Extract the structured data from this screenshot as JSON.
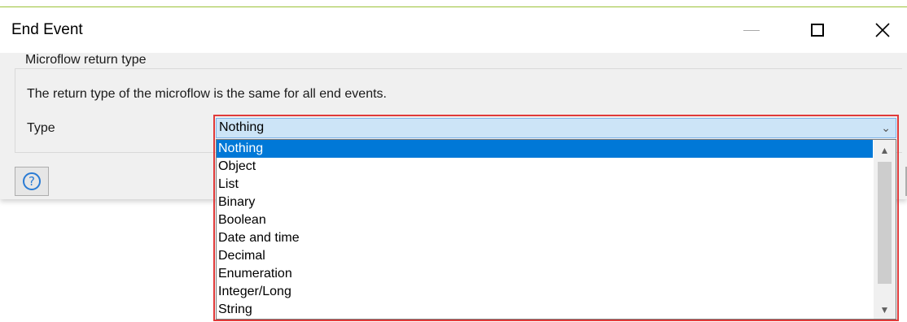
{
  "window": {
    "title": "End Event",
    "minimize_icon": "minimize-icon",
    "maximize_icon": "maximize-icon",
    "close_icon": "close-icon",
    "close_glyph": "✕"
  },
  "group": {
    "legend": "Microflow return type",
    "description": "The return type of the microflow is the same for all end events.",
    "type_label": "Type"
  },
  "type_select": {
    "selected": "Nothing",
    "options": [
      "Nothing",
      "Object",
      "List",
      "Binary",
      "Boolean",
      "Date and time",
      "Decimal",
      "Enumeration",
      "Integer/Long",
      "String"
    ],
    "chevron": "⌄"
  },
  "help": {
    "icon": "help-icon",
    "glyph": "?"
  },
  "colors": {
    "highlight": "#e03a3a",
    "selection": "#0078d7",
    "accent_border": "#9ec53a"
  }
}
